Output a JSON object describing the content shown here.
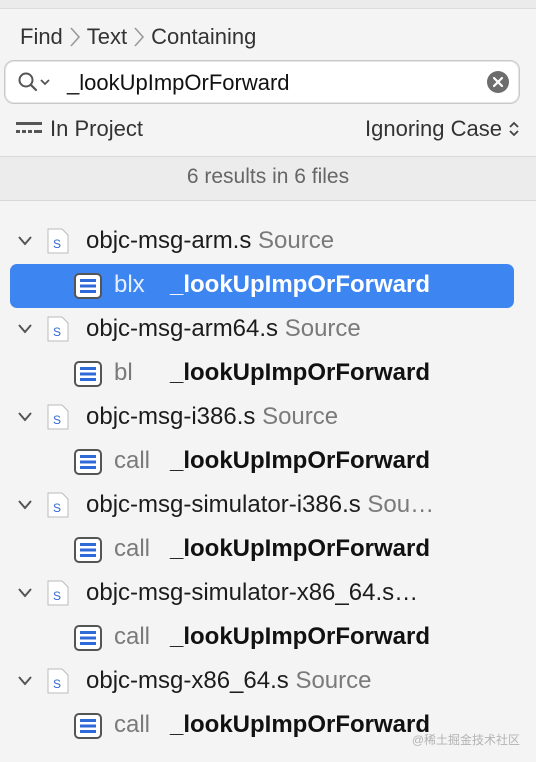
{
  "breadcrumb": {
    "items": [
      "Find",
      "Text",
      "Containing"
    ]
  },
  "search": {
    "value": "_lookUpImpOrForward",
    "icon": "magnifying-glass-icon",
    "clear_icon": "clear-icon"
  },
  "scope": {
    "label": "In Project",
    "case_label": "Ignoring Case"
  },
  "summary": "6 results in 6 files",
  "results": [
    {
      "file": "objc-msg-arm.s",
      "kind": "Source",
      "match_kw": "blx",
      "match_sym": "_lookUpImpOrForward",
      "selected": true
    },
    {
      "file": "objc-msg-arm64.s",
      "kind": "Source",
      "match_kw": "bl",
      "match_sym": "_lookUpImpOrForward",
      "selected": false
    },
    {
      "file": "objc-msg-i386.s",
      "kind": "Source",
      "match_kw": "call",
      "match_sym": "_lookUpImpOrForward",
      "selected": false
    },
    {
      "file": "objc-msg-simulator-i386.s",
      "kind": "Sou…",
      "match_kw": "call",
      "match_sym": "_lookUpImpOrForward",
      "selected": false
    },
    {
      "file": "objc-msg-simulator-x86_64.s…",
      "kind": "",
      "match_kw": "call",
      "match_sym": "_lookUpImpOrForward",
      "selected": false
    },
    {
      "file": "objc-msg-x86_64.s",
      "kind": "Source",
      "match_kw": "call",
      "match_sym": "_lookUpImpOrForward",
      "selected": false
    }
  ],
  "colors": {
    "selection": "#3d86f2",
    "file_icon_accent": "#2f6bd8"
  },
  "watermark": "@稀土掘金技术社区"
}
